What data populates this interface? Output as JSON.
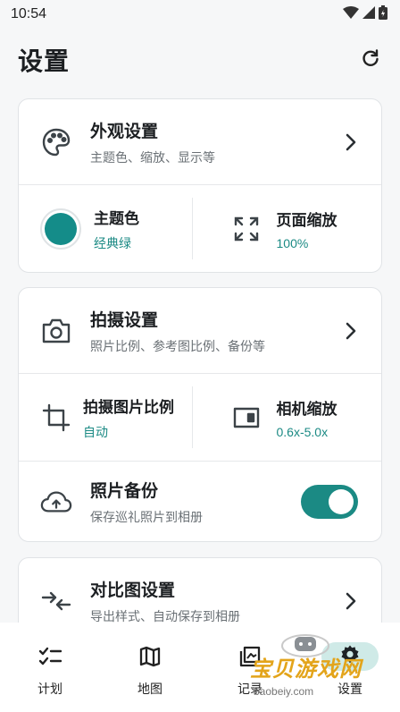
{
  "status_bar": {
    "time": "10:54"
  },
  "header": {
    "title": "设置"
  },
  "appearance": {
    "title": "外观设置",
    "subtitle": "主题色、缩放、显示等",
    "theme_color": {
      "label": "主题色",
      "value": "经典绿",
      "color": "#148c89"
    },
    "page_zoom": {
      "label": "页面缩放",
      "value": "100%"
    }
  },
  "capture": {
    "title": "拍摄设置",
    "subtitle": "照片比例、参考图比例、备份等",
    "ratio": {
      "label": "拍摄图片比例",
      "value": "自动"
    },
    "camera_zoom": {
      "label": "相机缩放",
      "value": "0.6x-5.0x"
    },
    "backup": {
      "label": "照片备份",
      "desc": "保存巡礼照片到相册",
      "enabled": true
    }
  },
  "compare": {
    "title": "对比图设置",
    "subtitle": "导出样式、自动保存到相册"
  },
  "nav": {
    "items": [
      {
        "label": "计划",
        "icon": "checklist-icon"
      },
      {
        "label": "地图",
        "icon": "map-icon"
      },
      {
        "label": "记录",
        "icon": "photo-library-icon"
      },
      {
        "label": "设置",
        "icon": "gear-icon"
      }
    ]
  },
  "watermark": {
    "text": "宝贝游戏网",
    "url": "baobeiy.com"
  },
  "colors": {
    "accent": "#1b8a84",
    "accent_light": "#cfeae7"
  }
}
